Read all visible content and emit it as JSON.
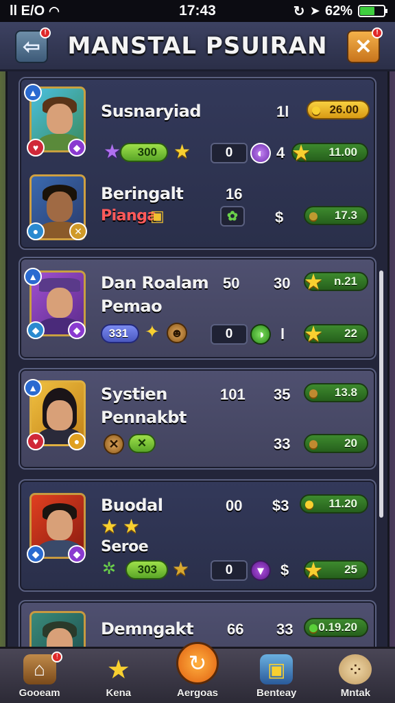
{
  "status_bar": {
    "carrier": "ll E/O",
    "time": "17:43",
    "battery_text": "62%",
    "battery_level": 0.62
  },
  "header": {
    "title": "MANSTAL PSUIRAN",
    "back_badge": "!",
    "close_label": "✕",
    "close_badge": "!"
  },
  "cards": [
    {
      "name": "Susnaryiad",
      "col1": "",
      "col2": "1l",
      "top_pill": "26.00",
      "pill_left": "300",
      "box_value": "0",
      "count": "4",
      "right_pill": "11.00"
    },
    {
      "name": "Beringalt",
      "subtitle": "Pianga",
      "col1": "16",
      "dollar": "$",
      "right_pill": "17.3"
    },
    {
      "name": "Dan Roalam",
      "subtitle": "Pemao",
      "col1": "50",
      "col2": "30",
      "top_pill": "n.21",
      "pill_left": "331",
      "box_value": "0",
      "count": "l",
      "right_pill": "22"
    },
    {
      "name": "Systien",
      "subtitle": "Pennakbt",
      "col1": "101",
      "col2": "35",
      "top_pill": "13.8",
      "count": "33",
      "right_pill": "20"
    },
    {
      "name": "Buodal",
      "subtitle": "Seroe",
      "col1": "00",
      "col2": "$3",
      "top_pill": "11.20",
      "pill_left": "303",
      "box_value": "0",
      "dollar": "$",
      "right_pill": "25"
    },
    {
      "name": "Demngakt",
      "col1": "66",
      "col2": "33",
      "top_pill": "0.19.20"
    }
  ],
  "bottom_nav": [
    {
      "label": "Gooeam",
      "icon": "home-icon"
    },
    {
      "label": "Kena",
      "icon": "star-icon"
    },
    {
      "label": "Aergoas",
      "icon": "spin-icon"
    },
    {
      "label": "Benteay",
      "icon": "box-icon"
    },
    {
      "label": "Mntak",
      "icon": "cookie-icon"
    }
  ],
  "colors": {
    "card_dark": "#33395a",
    "card_light": "#4f5070",
    "accent_gold": "#f8d030",
    "accent_green": "#3d8a2e"
  }
}
